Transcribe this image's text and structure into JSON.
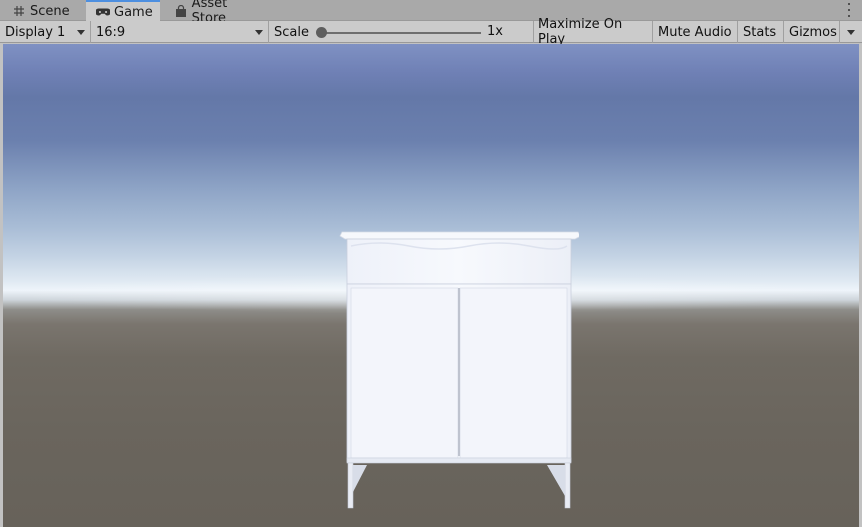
{
  "tabs": [
    {
      "label": "Scene",
      "icon": "grid-icon",
      "active": false
    },
    {
      "label": "Game",
      "icon": "gamepad-icon",
      "active": true
    },
    {
      "label": "Asset Store",
      "icon": "shopping-bag-icon",
      "active": false
    }
  ],
  "toolbar": {
    "display": "Display 1",
    "aspect": "16:9",
    "scale_label": "Scale",
    "scale_value": "1x",
    "scale_level": 0,
    "maximize_on_play": "Maximize On Play",
    "mute_audio": "Mute Audio",
    "stats": "Stats",
    "gizmos": "Gizmos"
  },
  "colors": {
    "active_tab_accent": "#4d8fe0",
    "toolbar_bg": "#cbcbcb",
    "tabbar_bg": "#a9a9a9",
    "sky_top": "#6478a8",
    "ground": "#6a655d",
    "cabinet": "#f4f6fb"
  }
}
